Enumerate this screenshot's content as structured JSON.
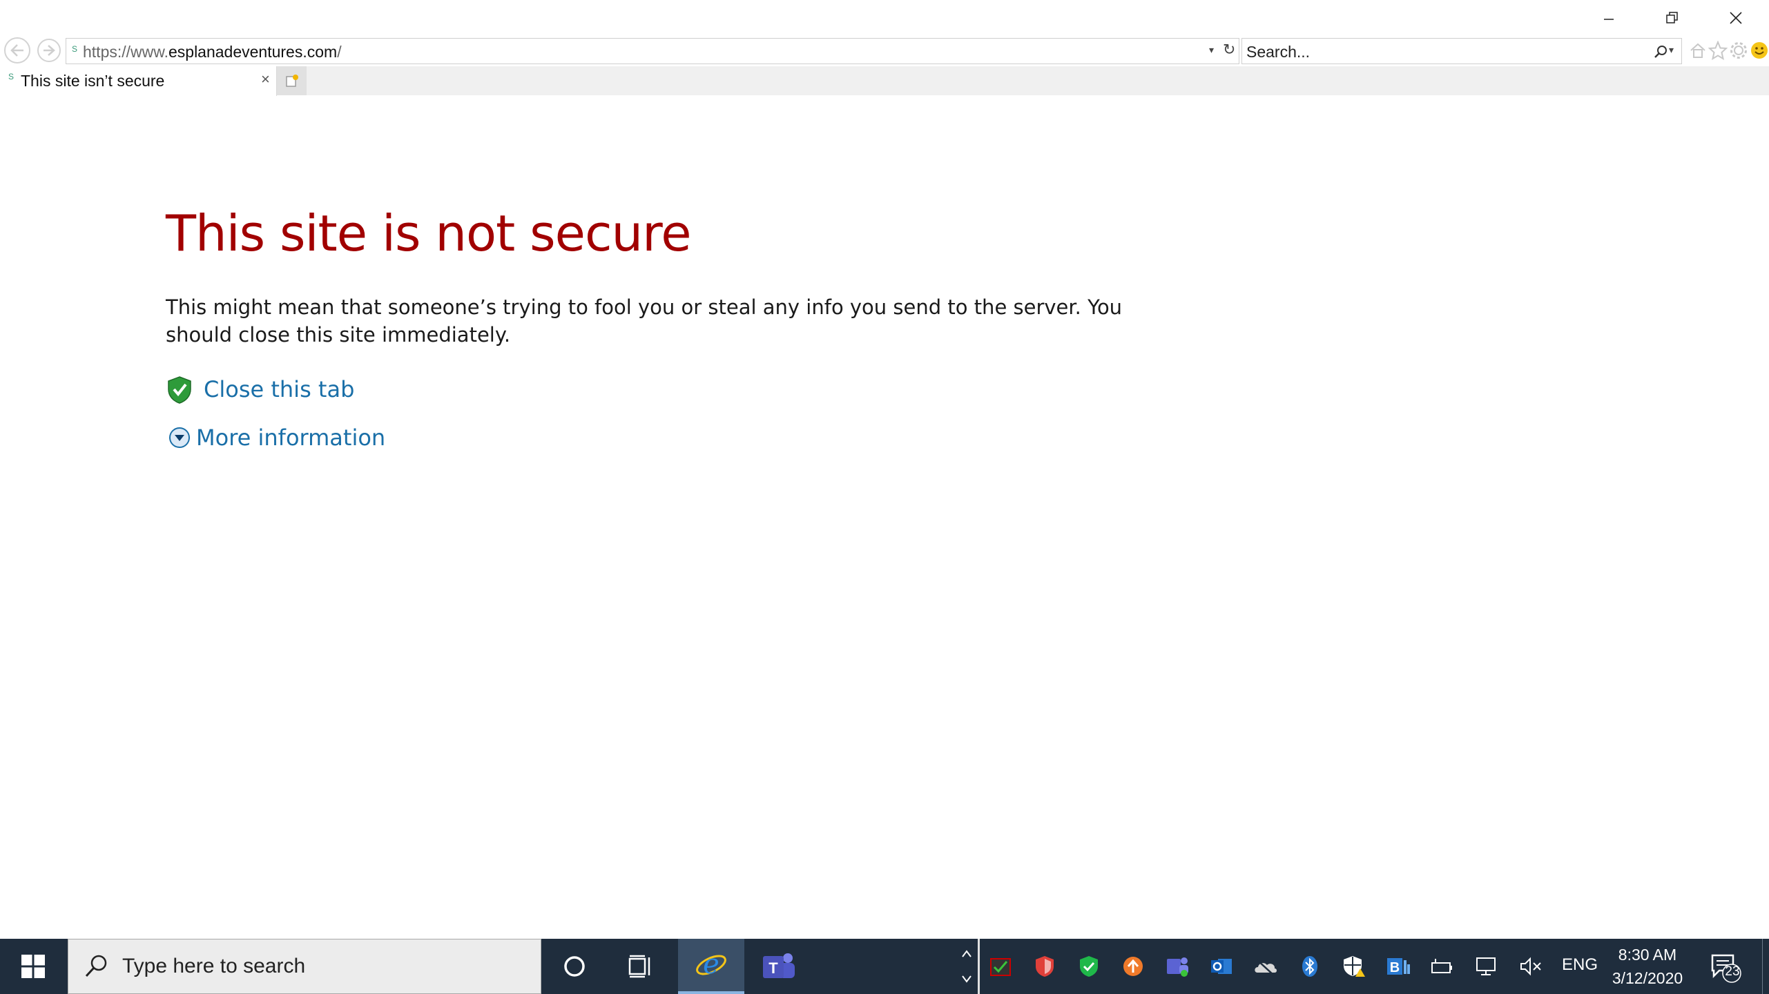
{
  "browser": {
    "url_prefix": "https://www.",
    "url_domain": "esplanadeventures.com",
    "url_suffix": "/",
    "search_placeholder": "Search...",
    "tab_title": "This site isn’t secure",
    "tab_close_glyph": "×"
  },
  "page": {
    "title": "This site is not secure",
    "body": "This might mean that someone’s trying to fool you or steal any info you send to the server. You should close this site immediately.",
    "close_tab_link": "Close this tab",
    "more_info_link": "More information"
  },
  "taskbar": {
    "search_placeholder": "Type here to search",
    "language": "ENG",
    "time": "8:30 AM",
    "date": "3/12/2020",
    "notification_count": "23"
  },
  "colors": {
    "title_red": "#a10000",
    "link_blue": "#1a6fa8",
    "taskbar_bg": "#1f2d3d"
  },
  "icons": [
    "minimize-icon",
    "restore-icon",
    "close-icon",
    "back-icon",
    "forward-icon",
    "site-icon",
    "dropdown-icon",
    "refresh-icon",
    "search-icon",
    "home-icon",
    "favorites-icon",
    "settings-icon",
    "smiley-icon",
    "new-tab-icon",
    "shield-check-icon",
    "expand-circle-icon",
    "windows-start-icon",
    "cortana-icon",
    "task-view-icon",
    "edge-icon",
    "teams-icon"
  ]
}
